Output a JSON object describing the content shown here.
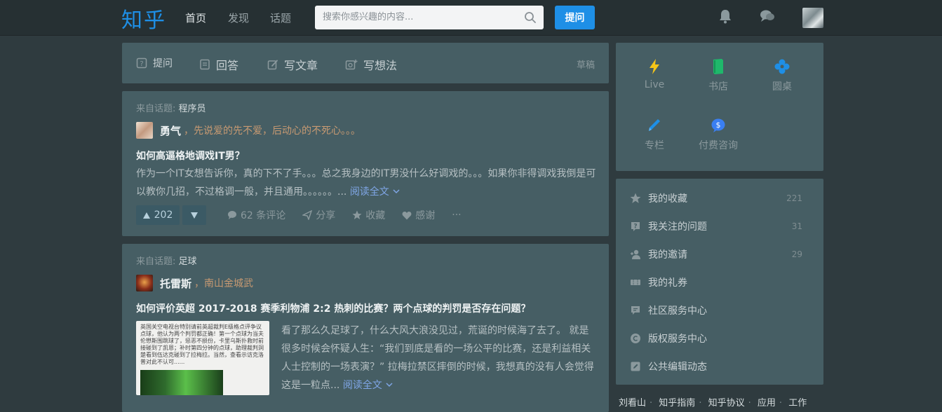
{
  "header": {
    "logo": "知乎",
    "nav": [
      "首页",
      "发现",
      "话题"
    ],
    "search_placeholder": "搜索你感兴趣的内容...",
    "ask_label": "提问"
  },
  "compose": {
    "ask": "提问",
    "answer": "回答",
    "article": "写文章",
    "idea": "写想法",
    "draft": "草稿"
  },
  "feed": [
    {
      "topic_prefix": "来自话题:",
      "topic": "程序员",
      "author": "勇气",
      "bio": "，先说爱的先不爱，后动心的不死心。。。",
      "title": "如何高逼格地调戏IT男？",
      "excerpt": "作为一个IT女想告诉你，真的下不了手。。。总之我身边的IT男没什么好调戏的。。。如果你非得调戏我倒是可以教你几招，不过格调一般，并且通用。。。。。。...",
      "read_more": "阅读全文",
      "votes": "202",
      "comments": "62 条评论",
      "share": "分享",
      "collect": "收藏",
      "thanks": "感谢",
      "more": "···"
    },
    {
      "topic_prefix": "来自话题:",
      "topic": "足球",
      "author": "托雷斯",
      "bio": "，南山金城武",
      "title": "如何评价英超 2017-2018 赛季利物浦 2:2 热刺的比赛？两个点球的判罚是否存在问题？",
      "thumb_text": "英国关空电视台特别请前英超裁判E级格点评争议点球，他认为两个判罚都正确！第一个点球为当夫伦懋斯围跳球了，惩恶不损份，卡里乌斯扑救时前接碰到了凯恩；补时第四分钟的点球，助理裁判洞楚看到伍达克碰到了拉梅拉。当然，查看示访克洛普对此不认可......",
      "excerpt": "看了那么久足球了，什么大风大浪没见过，荒诞的时候海了去了。 就是很多时候会怀疑人生：“我们到底是看的一场公平的比赛，还是利益相关人士控制的一场表演？” 拉梅拉禁区摔倒的时候，我想真的没有人会觉得这是一粒点...",
      "read_more": "阅读全文"
    }
  ],
  "sidebar": {
    "grid": [
      "Live",
      "书店",
      "圆桌",
      "专栏",
      "付费咨询"
    ],
    "list": [
      {
        "label": "我的收藏",
        "count": "221",
        "icon": "star-icon"
      },
      {
        "label": "我关注的问题",
        "count": "31",
        "icon": "question-icon"
      },
      {
        "label": "我的邀请",
        "count": "29",
        "icon": "invite-icon"
      },
      {
        "label": "我的礼券",
        "count": "",
        "icon": "coupon-icon"
      },
      {
        "label": "社区服务中心",
        "count": "",
        "icon": "service-icon"
      },
      {
        "label": "版权服务中心",
        "count": "",
        "icon": "copyright-icon"
      },
      {
        "label": "公共编辑动态",
        "count": "",
        "icon": "edit-icon"
      }
    ],
    "footer": [
      "刘看山",
      "知乎指南",
      "知乎协议",
      "应用",
      "工作"
    ]
  },
  "colors": {
    "brand": "#1e8fe6",
    "panel": "#465e64",
    "background": "#2f3b3f"
  }
}
